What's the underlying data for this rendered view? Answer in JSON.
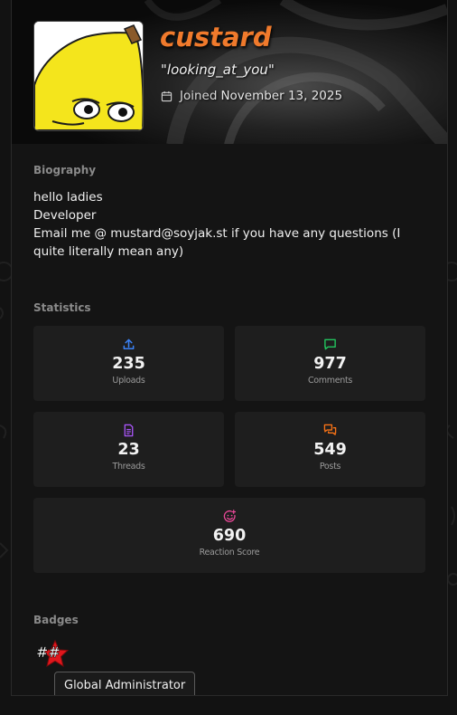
{
  "profile": {
    "username": "custard",
    "status": "\"looking_at_you\"",
    "joined_label": "Joined",
    "joined_date": "November 13, 2025",
    "avatar_icon": "pepe-banana-avatar",
    "username_color": "#f07a2c"
  },
  "biography": {
    "title": "Biography",
    "lines": [
      "hello ladies",
      "Developer",
      "Email me @ mustard@soyjak.st if you have any questions (I quite literally mean any)"
    ]
  },
  "statistics": {
    "title": "Statistics",
    "items": [
      {
        "icon": "upload-icon",
        "value": "235",
        "label": "Uploads",
        "color": "#3b82f6"
      },
      {
        "icon": "comment-icon",
        "value": "977",
        "label": "Comments",
        "color": "#22c55e"
      },
      {
        "icon": "document-icon",
        "value": "23",
        "label": "Threads",
        "color": "#a855f7"
      },
      {
        "icon": "messages-icon",
        "value": "549",
        "label": "Posts",
        "color": "#f97316"
      },
      {
        "icon": "smiley-plus-icon",
        "value": "690",
        "label": "Reaction Score",
        "color": "#ec4899"
      }
    ]
  },
  "badges": {
    "title": "Badges",
    "items": [
      {
        "icon": "hashtag-star-badge-icon",
        "glyph": "##",
        "tooltip": "Global Administrator"
      }
    ]
  }
}
